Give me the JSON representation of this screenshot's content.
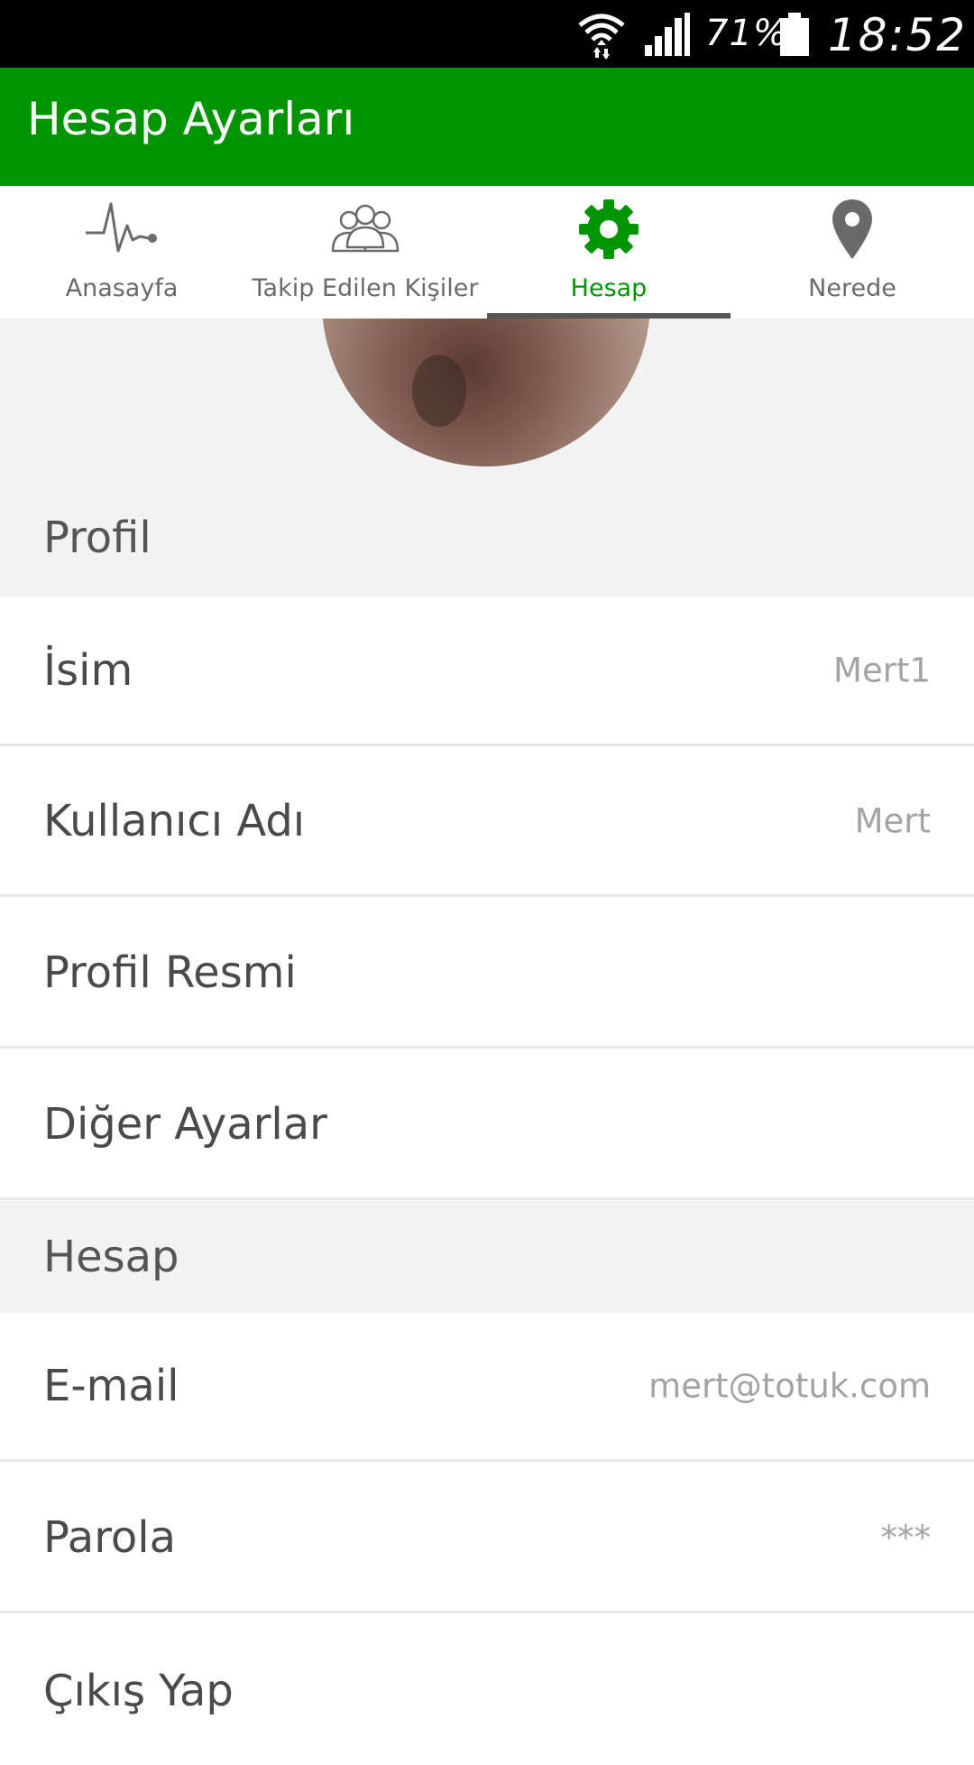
{
  "status_bar": {
    "battery_percent": "71%",
    "time": "18:52"
  },
  "app_bar": {
    "title": "Hesap Ayarları"
  },
  "tabs": [
    {
      "label": "Anasayfa",
      "icon": "pulse-icon"
    },
    {
      "label": "Takip Edilen Kişiler",
      "icon": "people-icon"
    },
    {
      "label": "Hesap",
      "icon": "gear-icon",
      "active": true
    },
    {
      "label": "Nerede",
      "icon": "location-pin-icon"
    }
  ],
  "colors": {
    "brand_green": "#009400",
    "status_bar": "#000000",
    "section_bg": "#f2f2f2",
    "tab_indicator": "#555555"
  },
  "sections": {
    "profil": {
      "header": "Profil",
      "rows": [
        {
          "label": "İsim",
          "value": "Mert1"
        },
        {
          "label": "Kullanıcı Adı",
          "value": "Mert"
        },
        {
          "label": "Profil Resmi",
          "value": ""
        },
        {
          "label": "Diğer Ayarlar",
          "value": ""
        }
      ]
    },
    "hesap": {
      "header": "Hesap",
      "rows": [
        {
          "label": "E-mail",
          "value": "mert@totuk.com"
        },
        {
          "label": "Parola",
          "value": "***"
        },
        {
          "label": "Çıkış Yap",
          "value": ""
        }
      ]
    }
  }
}
